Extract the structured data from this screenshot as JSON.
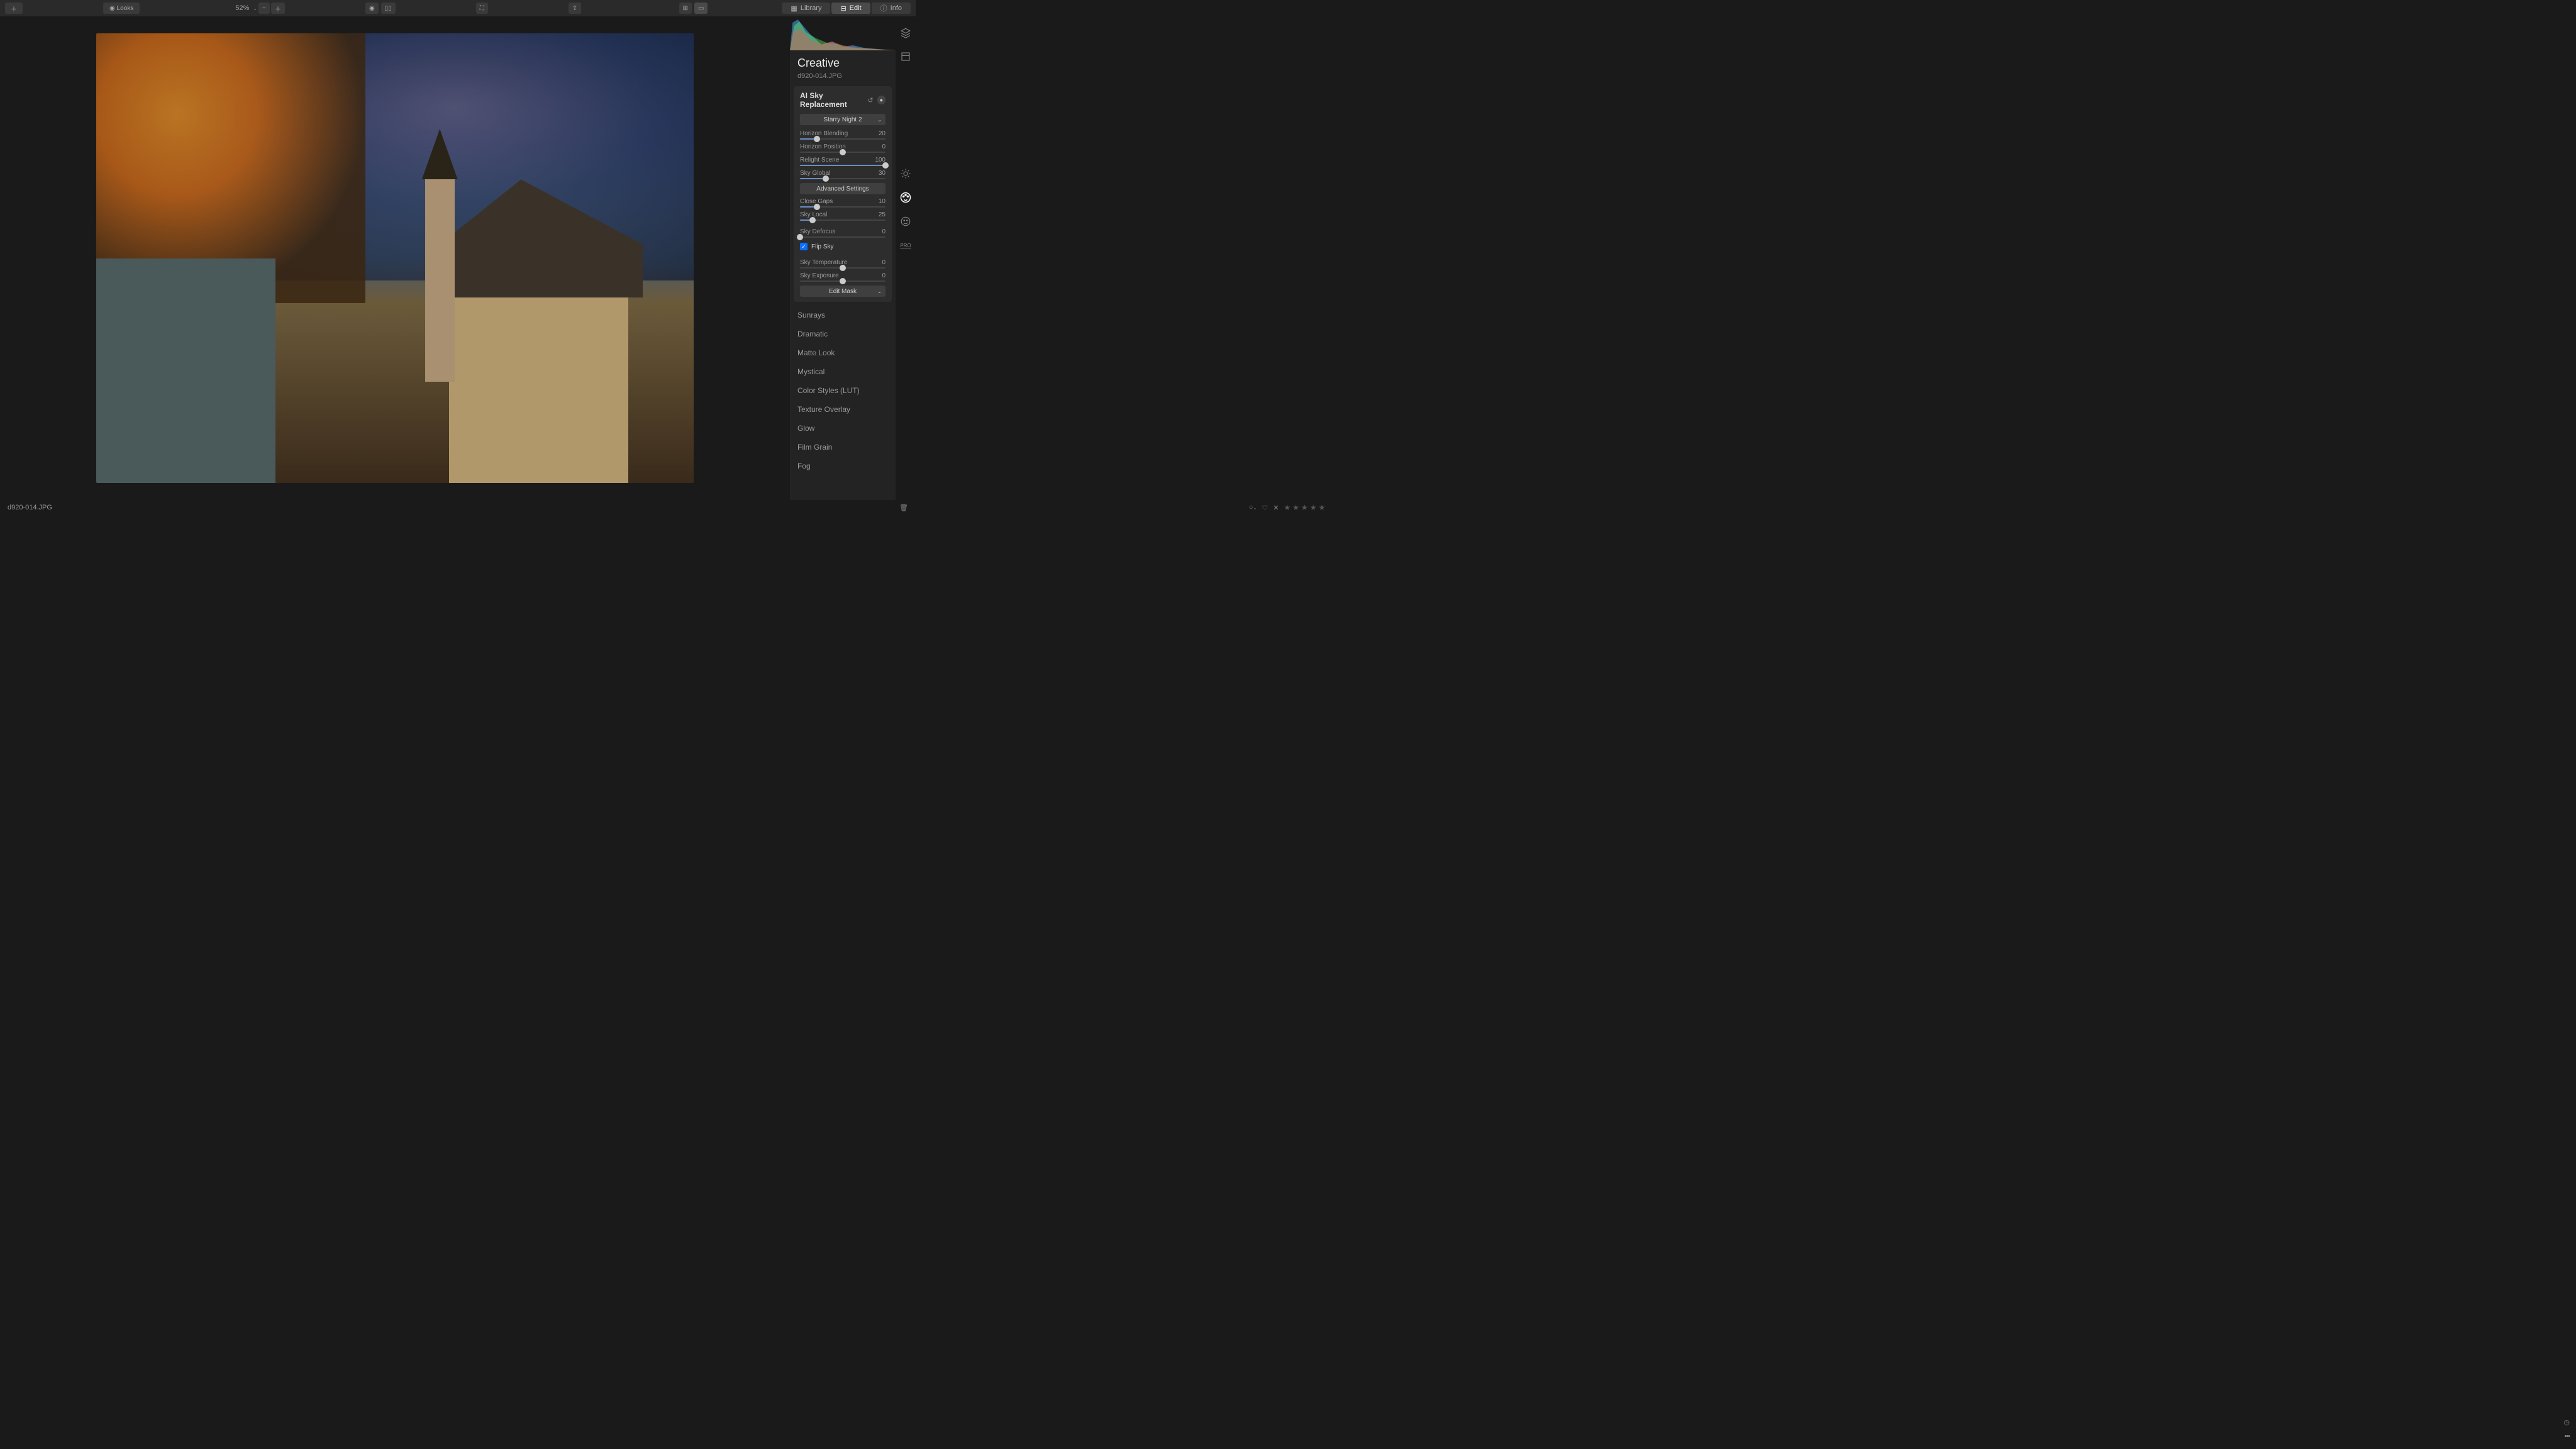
{
  "topbar": {
    "looks": "Looks",
    "zoom": "52%",
    "tabs": {
      "library": "Library",
      "edit": "Edit",
      "info": "Info"
    }
  },
  "panel": {
    "title": "Creative",
    "filename": "d920-014.JPG",
    "sky": {
      "title": "AI Sky Replacement",
      "preset": "Starry Night 2",
      "advanced": "Advanced Settings",
      "sliders": {
        "horizon_blending": {
          "label": "Horizon Blending",
          "value": 20
        },
        "horizon_position": {
          "label": "Horizon Position",
          "value": 0,
          "center": true
        },
        "relight_scene": {
          "label": "Relight Scene",
          "value": 100
        },
        "sky_global": {
          "label": "Sky Global",
          "value": 30
        },
        "close_gaps": {
          "label": "Close Gaps",
          "value": 10
        },
        "sky_local": {
          "label": "Sky Local",
          "value": 25
        },
        "sky_defocus": {
          "label": "Sky Defocus",
          "value": 0
        },
        "sky_temperature": {
          "label": "Sky Temperature",
          "value": 0,
          "center": true
        },
        "sky_exposure": {
          "label": "Sky Exposure",
          "value": 0,
          "center": true
        }
      },
      "flip": "Flip Sky",
      "edit_mask": "Edit Mask"
    },
    "tools": [
      "Sunrays",
      "Dramatic",
      "Matte Look",
      "Mystical",
      "Color Styles (LUT)",
      "Texture Overlay",
      "Glow",
      "Film Grain",
      "Fog"
    ]
  },
  "sidetools": {
    "pro": "PRO"
  },
  "bottombar": {
    "filename": "d920-014.JPG"
  }
}
